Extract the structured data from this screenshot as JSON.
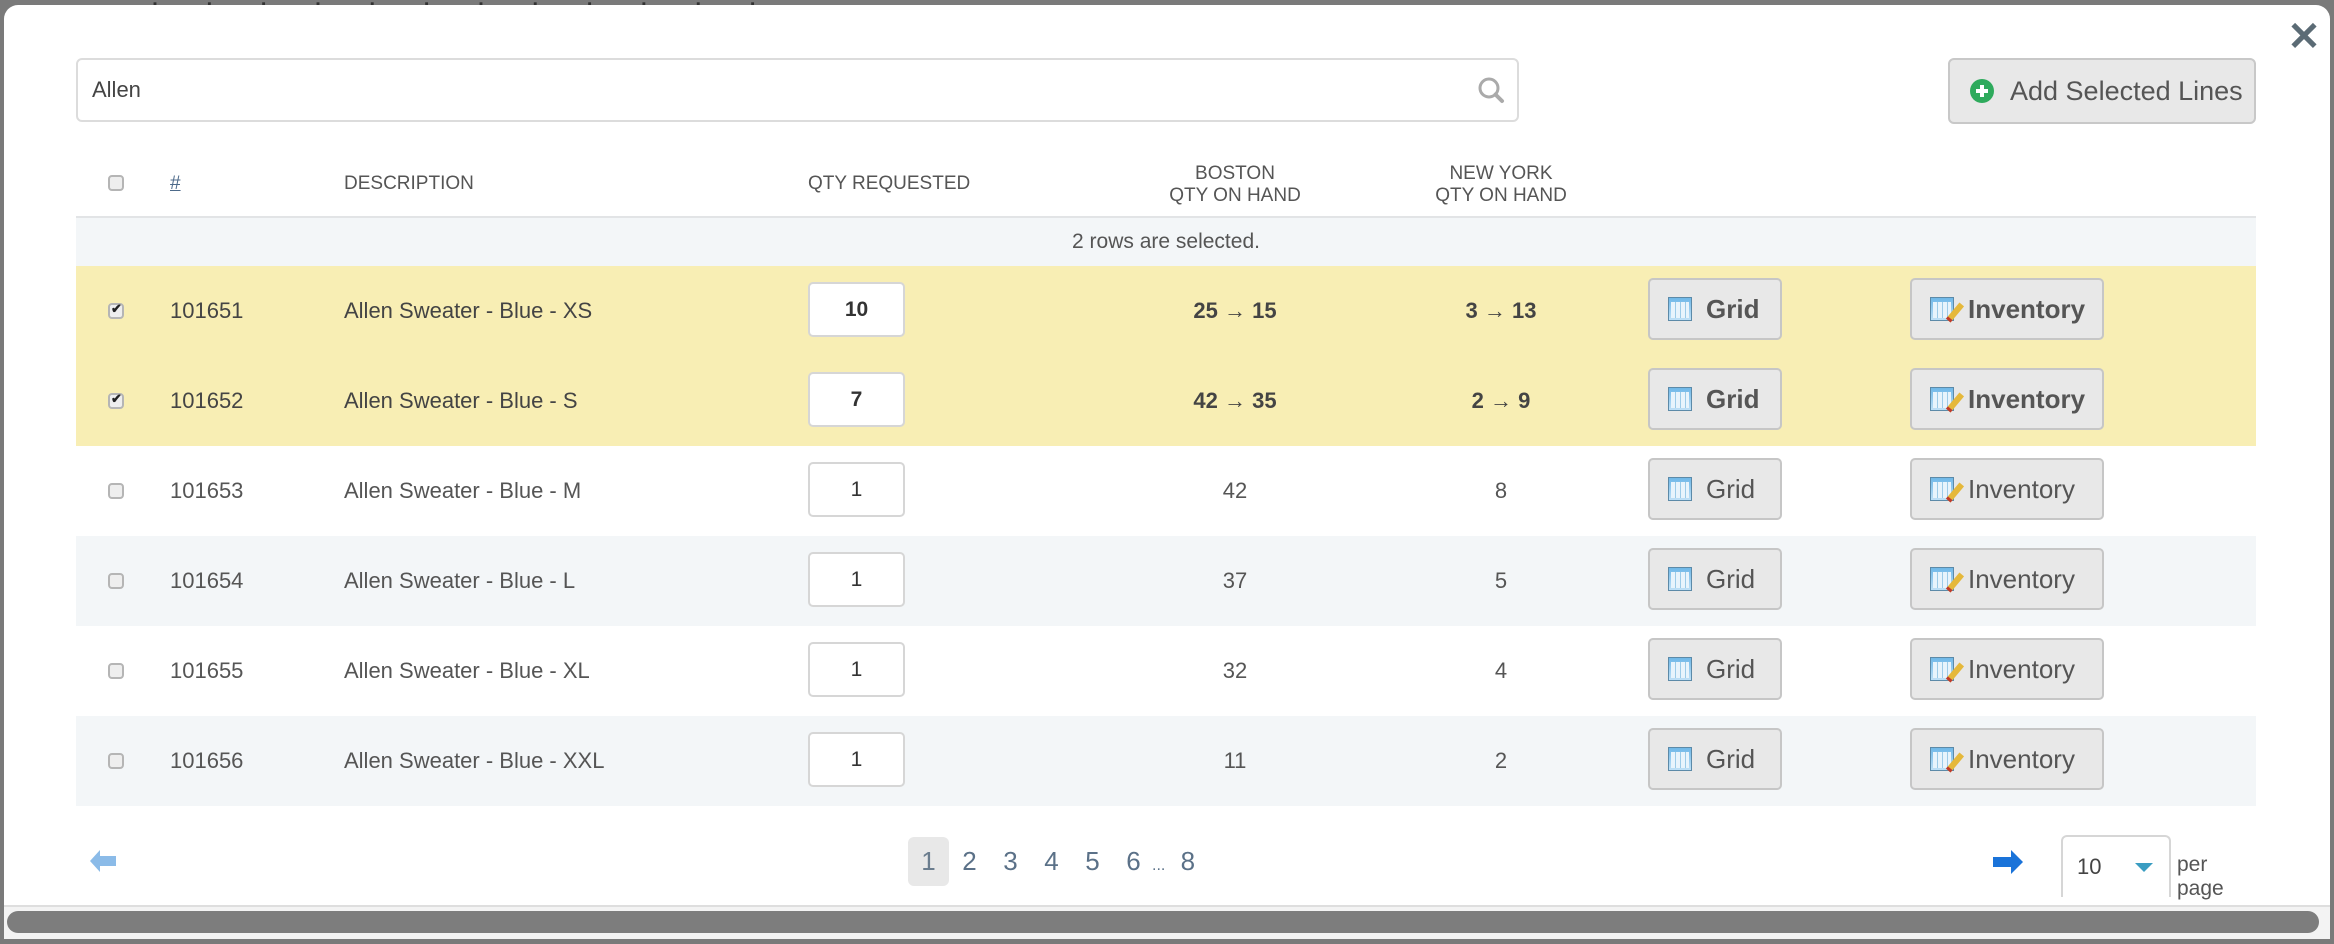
{
  "modal": {
    "close_icon": "close-icon"
  },
  "search": {
    "value": "Allen",
    "placeholder": "",
    "icon": "search-icon"
  },
  "add_button": {
    "label": "Add Selected Lines",
    "icon": "plus-circle-icon",
    "icon_color": "#2eaa5c"
  },
  "table": {
    "headers": {
      "select_all": "",
      "number": "#",
      "description": "DESCRIPTION",
      "qty_requested": "QTY REQUESTED",
      "boston_line1": "BOSTON",
      "boston_line2": "QTY ON HAND",
      "newyork_line1": "NEW YORK",
      "newyork_line2": "QTY ON HAND"
    },
    "selection_banner": "2 rows are selected.",
    "selected_row_color": "#f8eeb4",
    "rows": [
      {
        "selected": true,
        "number": "101651",
        "description": "Allen Sweater - Blue - XS",
        "qty": "10",
        "boston": "25 → 15",
        "newyork": "3 → 13",
        "grid_label": "Grid",
        "inventory_label": "Inventory"
      },
      {
        "selected": true,
        "number": "101652",
        "description": "Allen Sweater - Blue - S",
        "qty": "7",
        "boston": "42 → 35",
        "newyork": "2 → 9",
        "grid_label": "Grid",
        "inventory_label": "Inventory"
      },
      {
        "selected": false,
        "number": "101653",
        "description": "Allen Sweater - Blue - M",
        "qty": "1",
        "boston": "42",
        "newyork": "8",
        "grid_label": "Grid",
        "inventory_label": "Inventory"
      },
      {
        "selected": false,
        "number": "101654",
        "description": "Allen Sweater - Blue - L",
        "qty": "1",
        "boston": "37",
        "newyork": "5",
        "grid_label": "Grid",
        "inventory_label": "Inventory"
      },
      {
        "selected": false,
        "number": "101655",
        "description": "Allen Sweater - Blue - XL",
        "qty": "1",
        "boston": "32",
        "newyork": "4",
        "grid_label": "Grid",
        "inventory_label": "Inventory"
      },
      {
        "selected": false,
        "number": "101656",
        "description": "Allen Sweater - Blue - XXL",
        "qty": "1",
        "boston": "11",
        "newyork": "2",
        "grid_label": "Grid",
        "inventory_label": "Inventory"
      }
    ]
  },
  "pagination": {
    "pages": [
      "1",
      "2",
      "3",
      "4",
      "5",
      "6"
    ],
    "ellipsis": "...",
    "last_page": "8",
    "current_page": "1",
    "per_page_value": "10",
    "per_page_label": "per page",
    "prev_icon": "arrow-left-icon",
    "next_icon": "arrow-right-icon",
    "next_color": "#1a73d9",
    "prev_color": "#8bbbe8"
  }
}
